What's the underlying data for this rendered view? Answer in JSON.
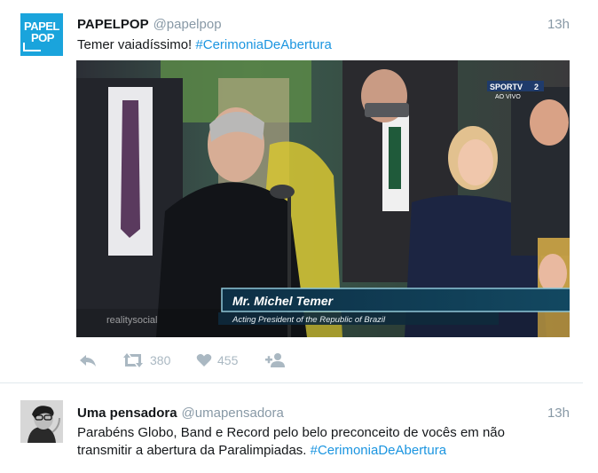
{
  "tweets": [
    {
      "account_name": "PAPELPOP",
      "handle": "@papelpop",
      "time": "13h",
      "text": "Temer vaiadíssimo!",
      "hashtag": "#CerimoniaDeAbertura",
      "avatar_lines": [
        "PAPEL",
        "POP"
      ],
      "media": {
        "broadcaster": "SPORTV",
        "channel": "2",
        "live_label": "AO VIVO",
        "caption_name": "Mr. Michel Temer",
        "caption_title": "Acting President of the Republic of Brazil",
        "watermark": "realitysocial"
      },
      "retweets": "380",
      "likes": "455"
    },
    {
      "account_name": "Uma pensadora",
      "handle": "@umapensadora",
      "time": "13h",
      "text": "Parabéns Globo, Band e Record pelo belo preconceito de vocês em não transmitir a abertura da Paralimpiadas.",
      "hashtag": "#CerimoniaDeAbertura"
    }
  ],
  "colors": {
    "link": "#1b95e0",
    "muted": "#8899a6",
    "icon": "#aab8c2",
    "divider": "#e1e8ed",
    "avatar_brand": "#1aa4dc"
  },
  "icons": [
    "reply-icon",
    "retweet-icon",
    "like-icon",
    "follow-icon"
  ]
}
